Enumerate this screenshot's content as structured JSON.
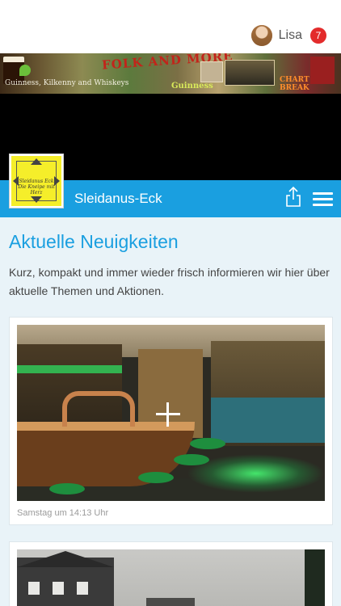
{
  "header": {
    "username": "Lisa",
    "notification_count": "7",
    "badge_color": "#e32b2b"
  },
  "banner": {
    "headline": "FOLK AND MORE",
    "drinks": "Guinness, Kilkenny and Whiskeys",
    "small_caption": "Guinness",
    "chart_caption": "CHART BREAK"
  },
  "logo": {
    "text": "Sleidanus Eck",
    "slogan": "Die Kneipe mit Herz"
  },
  "navbar": {
    "title": "Sleidanus-Eck",
    "accent_color": "#1a9fe0",
    "share_icon": "share-icon",
    "menu_icon": "hamburger-menu-icon"
  },
  "main": {
    "heading": "Aktuelle Neuigkeiten",
    "intro": "Kurz, kompakt und immer wieder frisch informieren wir hier über aktuelle Themen und Aktionen.",
    "posts": [
      {
        "date": "Samstag um 14:13 Uhr",
        "image": "pub interior photo"
      },
      {
        "date": "",
        "image": "street house photo"
      }
    ]
  }
}
